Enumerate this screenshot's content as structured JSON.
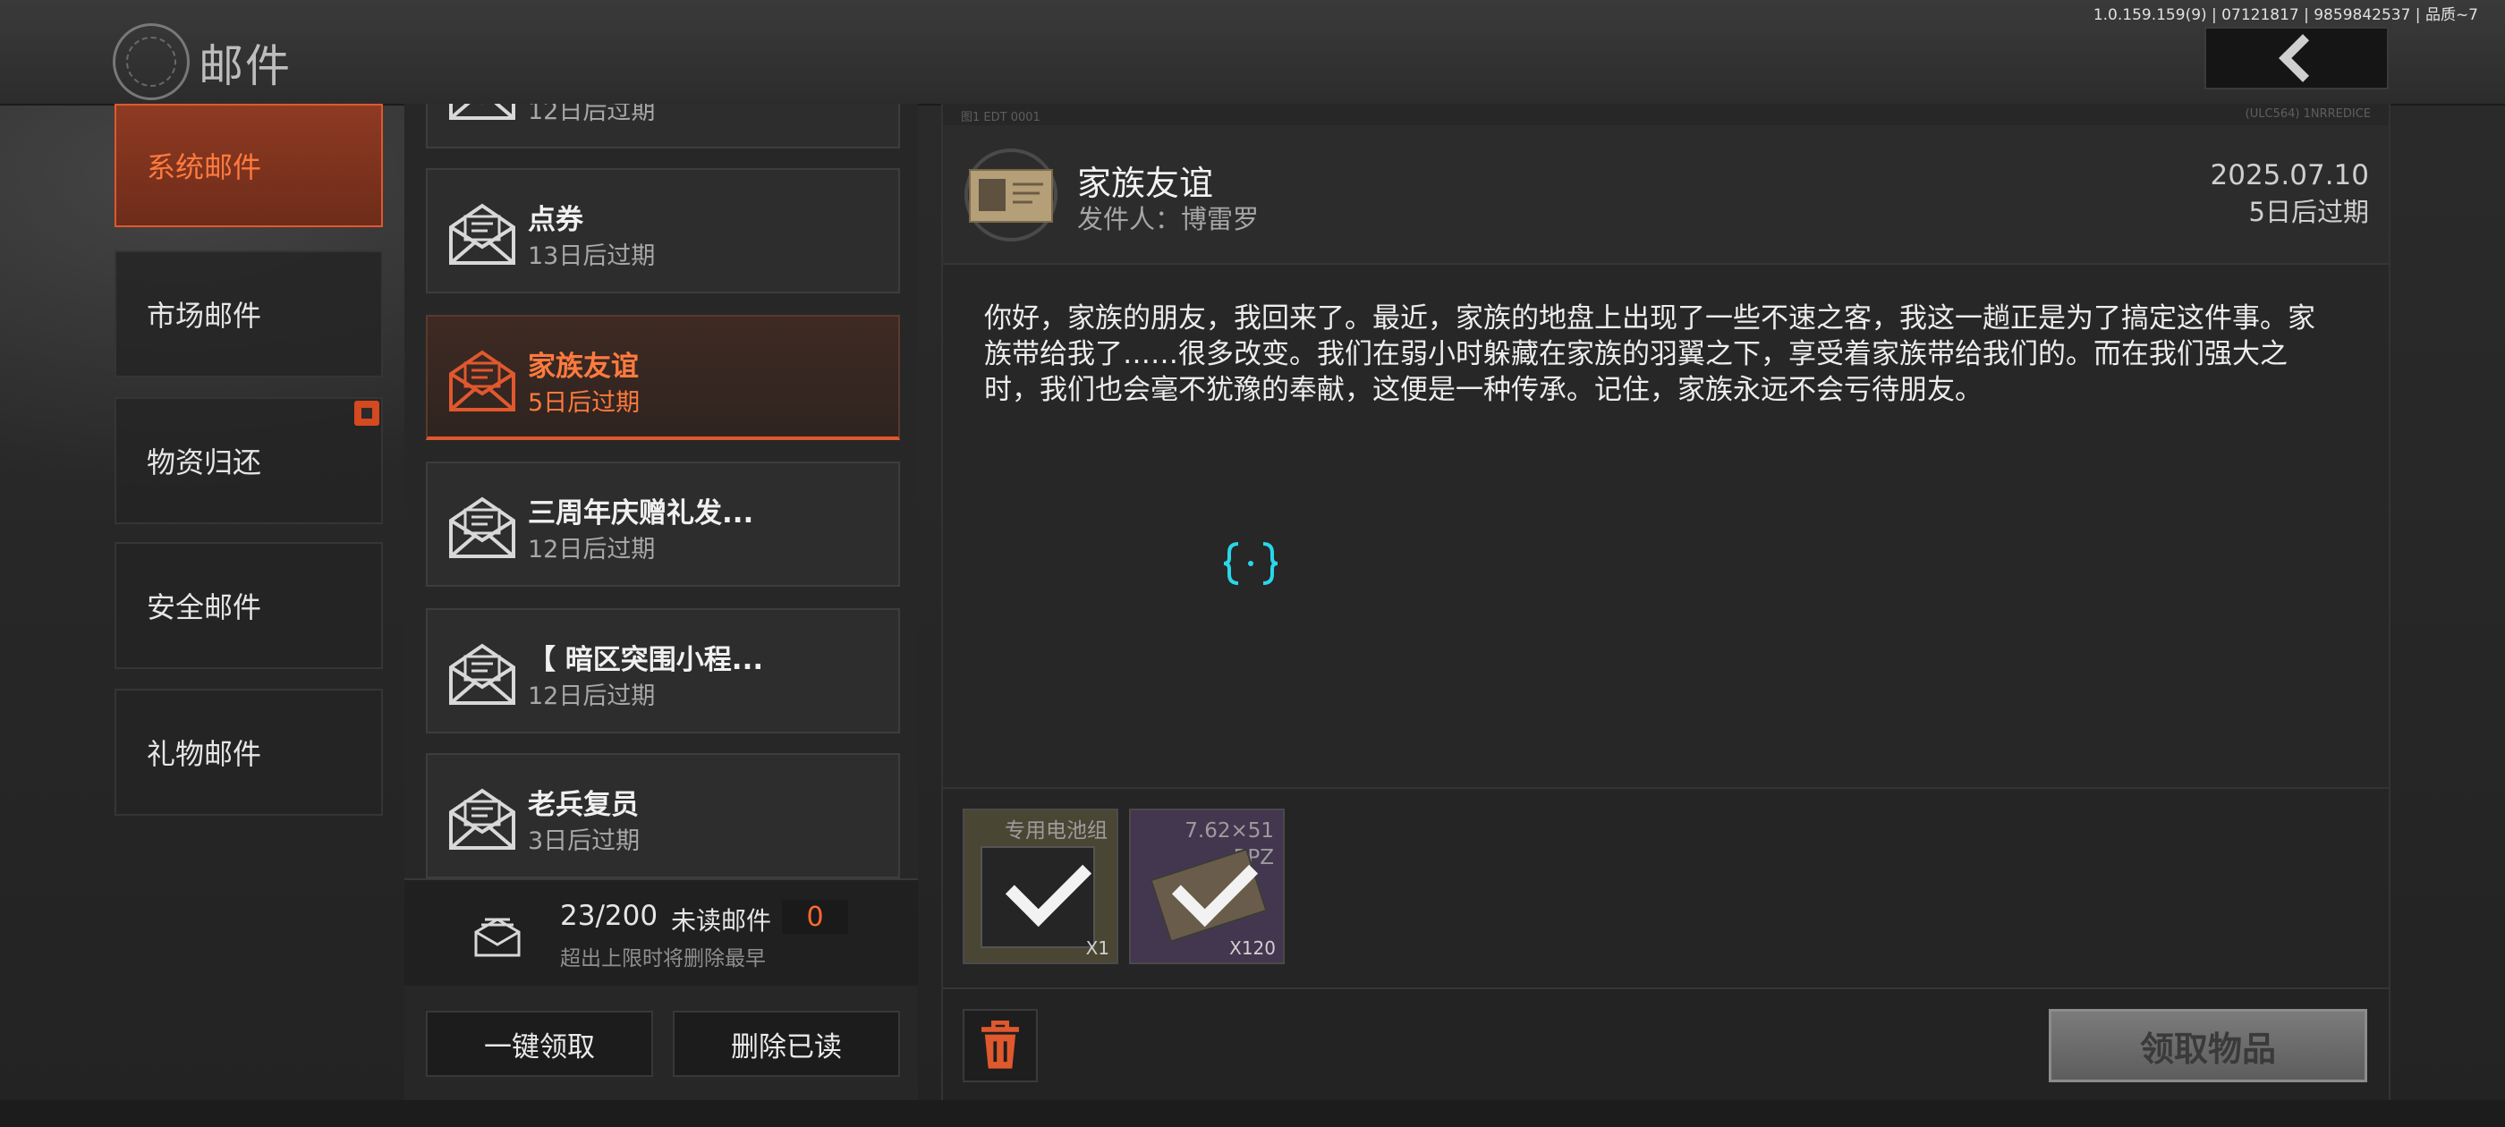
{
  "header": {
    "title": "邮件",
    "version": "1.0.159.159(9) | 07121817 | 9859842537 | 品质~7"
  },
  "categories": [
    {
      "label": "系统邮件",
      "active": true
    },
    {
      "label": "市场邮件",
      "active": false
    },
    {
      "label": "物资归还",
      "active": false,
      "badge": true
    },
    {
      "label": "安全邮件",
      "active": false
    },
    {
      "label": "礼物邮件",
      "active": false
    }
  ],
  "mails": [
    {
      "title": "",
      "expiry": "12日后过期"
    },
    {
      "title": "点券",
      "expiry": "13日后过期"
    },
    {
      "title": "家族友谊",
      "expiry": "5日后过期",
      "active": true
    },
    {
      "title": "三周年庆赠礼发...",
      "expiry": "12日后过期"
    },
    {
      "title": "【 暗区突围小程...",
      "expiry": "12日后过期"
    },
    {
      "title": "老兵复员",
      "expiry": "3日后过期"
    }
  ],
  "stats": {
    "count": "23/200",
    "unread_label": "未读邮件",
    "unread_count": "0",
    "limit_note": "超出上限时将删除最早"
  },
  "buttons": {
    "claim_all": "一键领取",
    "delete_read": "删除已读",
    "claim_items": "领取物品"
  },
  "detail": {
    "strip_left": "图1  EDT 0001",
    "strip_right": "(ULC564) 1NRREDICE",
    "title": "家族友谊",
    "sender": "发件人：博雷罗",
    "date": "2025.07.10",
    "expiry": "5日后过期",
    "body": "你好，家族的朋友，我回来了。最近，家族的地盘上出现了一些不速之客，我这一趟正是为了搞定这件事。家族带给我了……很多改变。我们在弱小时躲藏在家族的羽翼之下，享受着家族带给我们的。而在我们强大之时，我们也会毫不犹豫的奉献，这便是一种传承。记住，家族永远不会亏待朋友。"
  },
  "attachments": [
    {
      "name": "专用电池组",
      "qty": "X1",
      "bg": "#4a4634"
    },
    {
      "name": "7.62×51\nBPZ",
      "qty": "X120",
      "bg": "#43364f"
    }
  ],
  "colors": {
    "accent": "#e0582e",
    "accent_text": "#ff7a3e",
    "loader": "#2ad6e8"
  }
}
